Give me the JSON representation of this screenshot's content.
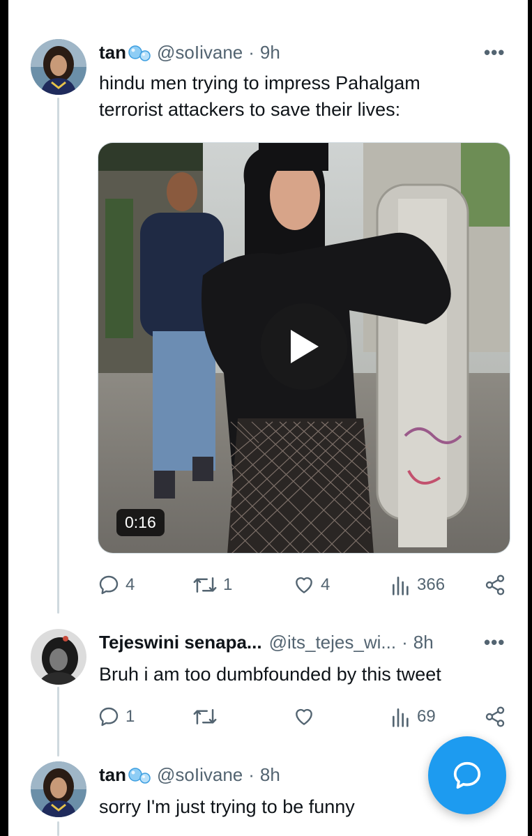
{
  "tweet": {
    "display_name": "tan",
    "handle": "@soIivane",
    "separator": "·",
    "time": "9h",
    "text_line1": "hindu men trying to impress Pahalgam",
    "text_line2": "terrorist attackers to save their lives:",
    "more": "•••",
    "media": {
      "duration": "0:16"
    },
    "actions": {
      "replies": "4",
      "reposts": "1",
      "likes": "4",
      "views": "366"
    }
  },
  "reply1": {
    "display_name": "Tejeswini senapa...",
    "handle": "@its_tejes_wi...",
    "separator": "·",
    "time": "8h",
    "text": "Bruh i am too dumbfounded by this tweet",
    "more": "•••",
    "actions": {
      "replies": "1",
      "reposts": "",
      "likes": "",
      "views": "69"
    }
  },
  "reply2": {
    "display_name": "tan",
    "handle": "@soIivane",
    "separator": "·",
    "time": "8h",
    "text": "sorry I'm just trying to be funny"
  },
  "colors": {
    "accent": "#1d9bf0",
    "muted": "#536471",
    "text": "#0f1419",
    "thread_line": "#cfd9de"
  },
  "icons": [
    "reply-icon",
    "repost-icon",
    "like-icon",
    "views-icon",
    "share-icon",
    "play-icon",
    "compose-reply-icon",
    "verified-bubble-icon"
  ]
}
